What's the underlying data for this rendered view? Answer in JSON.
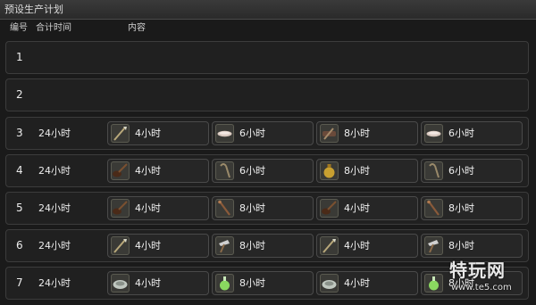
{
  "window": {
    "title": "预设生产计划"
  },
  "columns": {
    "id": "编号",
    "total_time": "合计时间",
    "content": "内容"
  },
  "rows": [
    {
      "id": "1",
      "total_time": "",
      "slots": []
    },
    {
      "id": "2",
      "total_time": "",
      "slots": []
    },
    {
      "id": "3",
      "total_time": "24小时",
      "slots": [
        {
          "icon": "spear-icon",
          "duration": "4小时"
        },
        {
          "icon": "shell-icon",
          "duration": "6小时"
        },
        {
          "icon": "brush-icon",
          "duration": "8小时"
        },
        {
          "icon": "shell-icon",
          "duration": "6小时"
        }
      ]
    },
    {
      "id": "4",
      "total_time": "24小时",
      "slots": [
        {
          "icon": "ladle-icon",
          "duration": "4小时"
        },
        {
          "icon": "cane-icon",
          "duration": "6小时"
        },
        {
          "icon": "pouch-icon",
          "duration": "8小时"
        },
        {
          "icon": "cane-icon",
          "duration": "6小时"
        }
      ]
    },
    {
      "id": "5",
      "total_time": "24小时",
      "slots": [
        {
          "icon": "ladle-icon",
          "duration": "4小时"
        },
        {
          "icon": "staff-icon",
          "duration": "8小时"
        },
        {
          "icon": "ladle-icon",
          "duration": "4小时"
        },
        {
          "icon": "staff-icon",
          "duration": "8小时"
        }
      ]
    },
    {
      "id": "6",
      "total_time": "24小时",
      "slots": [
        {
          "icon": "spear-icon",
          "duration": "4小时"
        },
        {
          "icon": "hammer-icon",
          "duration": "8小时"
        },
        {
          "icon": "spear-icon",
          "duration": "4小时"
        },
        {
          "icon": "hammer-icon",
          "duration": "8小时"
        }
      ]
    },
    {
      "id": "7",
      "total_time": "24小时",
      "slots": [
        {
          "icon": "mortar-icon",
          "duration": "4小时"
        },
        {
          "icon": "potion-icon",
          "duration": "8小时"
        },
        {
          "icon": "mortar-icon",
          "duration": "4小时"
        },
        {
          "icon": "potion-icon",
          "duration": "8小时"
        }
      ]
    }
  ],
  "watermark": {
    "logo": "特玩网",
    "url": "www.te5.com"
  }
}
